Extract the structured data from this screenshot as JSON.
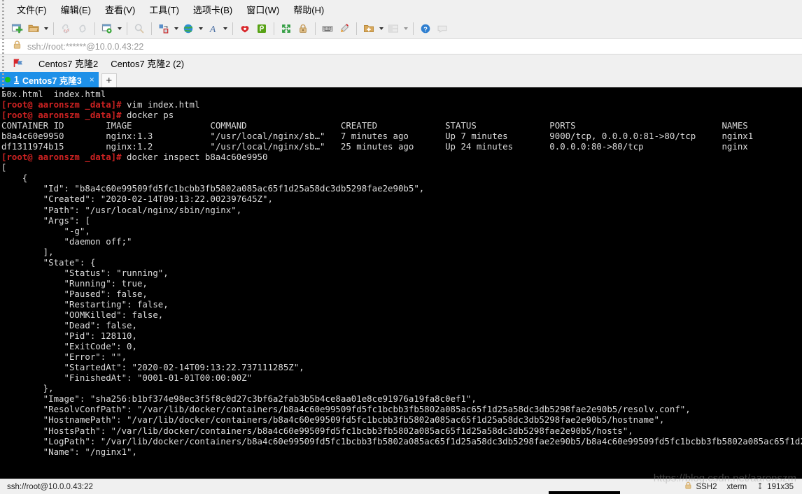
{
  "window": {
    "menu": [
      {
        "label": "文件(F)",
        "name": "menu-file"
      },
      {
        "label": "编辑(E)",
        "name": "menu-edit"
      },
      {
        "label": "查看(V)",
        "name": "menu-view"
      },
      {
        "label": "工具(T)",
        "name": "menu-tools"
      },
      {
        "label": "选项卡(B)",
        "name": "menu-tabs"
      },
      {
        "label": "窗口(W)",
        "name": "menu-window"
      },
      {
        "label": "帮助(H)",
        "name": "menu-help"
      }
    ]
  },
  "toolbar": {
    "items": [
      {
        "name": "new-session-icon",
        "title": "新建会话"
      },
      {
        "name": "open-folder-icon",
        "title": "打开"
      },
      {
        "name": "disconnect-icon",
        "title": "断开连接"
      },
      {
        "name": "connect-icon",
        "title": "连接"
      },
      {
        "name": "session-options-icon",
        "title": "会话选项"
      },
      {
        "name": "search-icon",
        "title": "查找"
      },
      {
        "name": "transfer-icon",
        "title": "传输"
      },
      {
        "name": "globe-icon",
        "title": "网络"
      },
      {
        "name": "font-icon",
        "title": "字体"
      },
      {
        "name": "log-icon",
        "title": "日志"
      },
      {
        "name": "script-icon",
        "title": "脚本"
      },
      {
        "name": "fullscreen-icon",
        "title": "全屏"
      },
      {
        "name": "lock-icon",
        "title": "锁定"
      },
      {
        "name": "keyboard-icon",
        "title": "键盘"
      },
      {
        "name": "highlight-icon",
        "title": "高亮"
      },
      {
        "name": "add-folder-icon",
        "title": "新建文件夹"
      },
      {
        "name": "layout-icon",
        "title": "布局"
      },
      {
        "name": "help-icon",
        "title": "帮助"
      },
      {
        "name": "chat-icon",
        "title": "聊天"
      }
    ]
  },
  "address": {
    "lock_icon": "lock-icon",
    "url": "ssh://root:******@10.0.0.43:22"
  },
  "bookmarks": {
    "flag_icon": "flag-icon",
    "links": [
      {
        "label": "Centos7 克隆2"
      },
      {
        "label": "Centos7 克隆2 (2)"
      }
    ]
  },
  "tabs": {
    "active": {
      "number": "1",
      "label": " Centos7 克隆3",
      "close": "×"
    },
    "add_label": "+"
  },
  "terminal": {
    "lines": [
      {
        "segments": [
          {
            "t": "50x.html  index.html",
            "c": "w"
          }
        ]
      },
      {
        "segments": [
          {
            "t": "[root@ aaronszm _data]#",
            "c": "r"
          },
          {
            "t": " vim index.html",
            "c": "w"
          }
        ]
      },
      {
        "segments": [
          {
            "t": "[root@ aaronszm _data]#",
            "c": "r"
          },
          {
            "t": " docker ps",
            "c": "w"
          }
        ]
      },
      {
        "segments": [
          {
            "t": "CONTAINER ID        IMAGE               COMMAND                  CREATED             STATUS              PORTS                            NAMES",
            "c": "w"
          }
        ]
      },
      {
        "segments": [
          {
            "t": "b8a4c60e9950        nginx:1.3           \"/usr/local/nginx/sb…\"   7 minutes ago       Up 7 minutes        9000/tcp, 0.0.0.0:81->80/tcp     nginx1",
            "c": "w"
          }
        ]
      },
      {
        "segments": [
          {
            "t": "df1311974b15        nginx:1.2           \"/usr/local/nginx/sb…\"   25 minutes ago      Up 24 minutes       0.0.0.0:80->80/tcp               nginx",
            "c": "w"
          }
        ]
      },
      {
        "segments": [
          {
            "t": "[root@ aaronszm _data]#",
            "c": "r"
          },
          {
            "t": " docker inspect b8a4c60e9950",
            "c": "w"
          }
        ]
      },
      {
        "segments": [
          {
            "t": "[",
            "c": "w"
          }
        ]
      },
      {
        "segments": [
          {
            "t": "    {",
            "c": "w"
          }
        ]
      },
      {
        "segments": [
          {
            "t": "        \"Id\": \"b8a4c60e99509fd5fc1bcbb3fb5802a085ac65f1d25a58dc3db5298fae2e90b5\",",
            "c": "w"
          }
        ]
      },
      {
        "segments": [
          {
            "t": "        \"Created\": \"2020-02-14T09:13:22.002397645Z\",",
            "c": "w"
          }
        ]
      },
      {
        "segments": [
          {
            "t": "        \"Path\": \"/usr/local/nginx/sbin/nginx\",",
            "c": "w"
          }
        ]
      },
      {
        "segments": [
          {
            "t": "        \"Args\": [",
            "c": "w"
          }
        ]
      },
      {
        "segments": [
          {
            "t": "            \"-g\",",
            "c": "w"
          }
        ]
      },
      {
        "segments": [
          {
            "t": "            \"daemon off;\"",
            "c": "w"
          }
        ]
      },
      {
        "segments": [
          {
            "t": "        ],",
            "c": "w"
          }
        ]
      },
      {
        "segments": [
          {
            "t": "        \"State\": {",
            "c": "w"
          }
        ]
      },
      {
        "segments": [
          {
            "t": "            \"Status\": \"running\",",
            "c": "w"
          }
        ]
      },
      {
        "segments": [
          {
            "t": "            \"Running\": true,",
            "c": "w"
          }
        ]
      },
      {
        "segments": [
          {
            "t": "            \"Paused\": false,",
            "c": "w"
          }
        ]
      },
      {
        "segments": [
          {
            "t": "            \"Restarting\": false,",
            "c": "w"
          }
        ]
      },
      {
        "segments": [
          {
            "t": "            \"OOMKilled\": false,",
            "c": "w"
          }
        ]
      },
      {
        "segments": [
          {
            "t": "            \"Dead\": false,",
            "c": "w"
          }
        ]
      },
      {
        "segments": [
          {
            "t": "            \"Pid\": 128110,",
            "c": "w"
          }
        ]
      },
      {
        "segments": [
          {
            "t": "            \"ExitCode\": 0,",
            "c": "w"
          }
        ]
      },
      {
        "segments": [
          {
            "t": "            \"Error\": \"\",",
            "c": "w"
          }
        ]
      },
      {
        "segments": [
          {
            "t": "            \"StartedAt\": \"2020-02-14T09:13:22.737111285Z\",",
            "c": "w"
          }
        ]
      },
      {
        "segments": [
          {
            "t": "            \"FinishedAt\": \"0001-01-01T00:00:00Z\"",
            "c": "w"
          }
        ]
      },
      {
        "segments": [
          {
            "t": "        },",
            "c": "w"
          }
        ]
      },
      {
        "segments": [
          {
            "t": "        \"Image\": \"sha256:b1bf374e98ec3f5f8c0d27c3bf6a2fab3b5b4ce8aa01e8ce91976a19fa8c0ef1\",",
            "c": "w"
          }
        ]
      },
      {
        "segments": [
          {
            "t": "        \"ResolvConfPath\": \"/var/lib/docker/containers/b8a4c60e99509fd5fc1bcbb3fb5802a085ac65f1d25a58dc3db5298fae2e90b5/resolv.conf\",",
            "c": "w"
          }
        ]
      },
      {
        "segments": [
          {
            "t": "        \"HostnamePath\": \"/var/lib/docker/containers/b8a4c60e99509fd5fc1bcbb3fb5802a085ac65f1d25a58dc3db5298fae2e90b5/hostname\",",
            "c": "w"
          }
        ]
      },
      {
        "segments": [
          {
            "t": "        \"HostsPath\": \"/var/lib/docker/containers/b8a4c60e99509fd5fc1bcbb3fb5802a085ac65f1d25a58dc3db5298fae2e90b5/hosts\",",
            "c": "w"
          }
        ]
      },
      {
        "segments": [
          {
            "t": "        \"LogPath\": \"/var/lib/docker/containers/b8a4c60e99509fd5fc1bcbb3fb5802a085ac65f1d25a58dc3db5298fae2e90b5/b8a4c60e99509fd5fc1bcbb3fb5802a085ac65f1d25a58dc3db",
            "c": "w"
          }
        ]
      },
      {
        "segments": [
          {
            "t": "        \"Name\": \"/nginx1\",",
            "c": "w"
          }
        ]
      }
    ]
  },
  "statusbar": {
    "connection": "ssh://root@10.0.0.43:22",
    "lock_icon": "lock-icon",
    "protocol": "SSH2",
    "emulation": "xterm",
    "size_icon": "resize-icon",
    "size": "191x35"
  },
  "watermark": "https://blog.csdn.net/aaronszm",
  "colors": {
    "accent": "#1e90e8",
    "terminal_bg": "#000000",
    "terminal_fg": "#d8d8d8",
    "prompt_red": "#cc2222",
    "chrome_bg": "#f0f0f0"
  }
}
